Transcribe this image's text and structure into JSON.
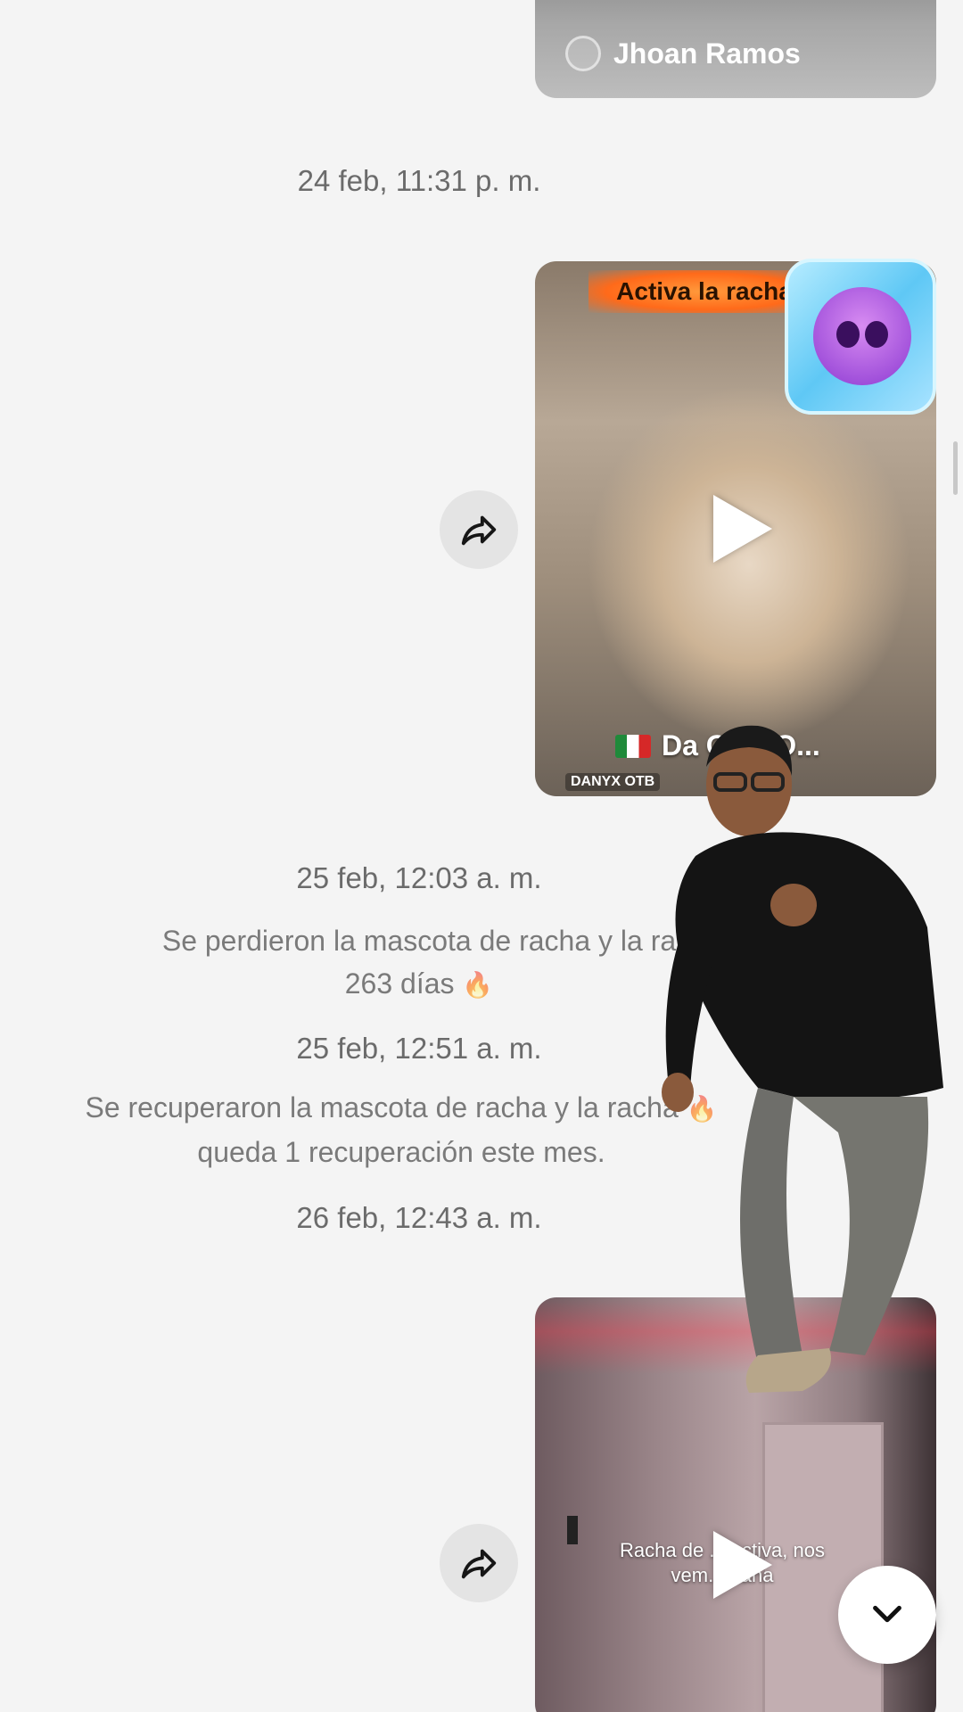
{
  "top_card": {
    "author": "Jhoan Ramos"
  },
  "messages": [
    {
      "timestamp": "24 feb, 11:31 p. m."
    },
    {
      "timestamp": "25 feb, 12:03 a. m."
    },
    {
      "system_line1": "Se perdieron la mascota de racha y la ra",
      "system_line2": "263 días",
      "system_emoji": "🔥"
    },
    {
      "timestamp": "25 feb, 12:51 a. m."
    },
    {
      "system_line1": "Se recuperaron la mascota de racha y la racha",
      "system_emoji": "🔥",
      "system_line2": "queda 1 recuperación este mes."
    },
    {
      "timestamp": "26 feb, 12:43 a. m."
    }
  ],
  "video1": {
    "banner": "Activa la racha",
    "caption": "Da OTB O...",
    "watermark": "DANYX OTB"
  },
  "video2": {
    "subtitle": "Racha de ... activa, nos vem... ñana"
  },
  "icons": {
    "share": "share-arrow-icon",
    "play": "play-icon",
    "scroll": "chevron-down-icon"
  },
  "colors": {
    "background": "#f4f4f4",
    "timestamp": "#6b6b6b",
    "system_text": "#7a7a7a"
  }
}
